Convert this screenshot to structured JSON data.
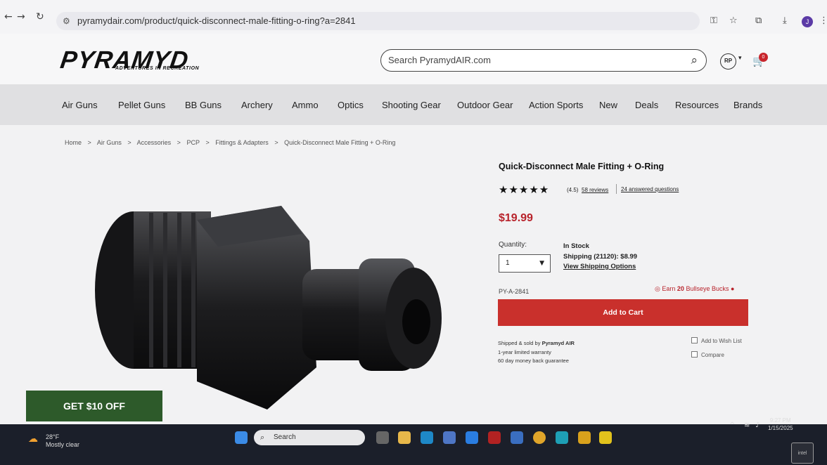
{
  "browser": {
    "url": "pyramydair.com/product/quick-disconnect-male-fitting-o-ring?a=2841",
    "profile_letter": "J"
  },
  "header": {
    "logo": "PYRAMYD",
    "tagline": "ADVENTURES IN RECREATION",
    "search_placeholder": "Search PyramydAIR.com",
    "account_initials": "RP",
    "cart_count": "0"
  },
  "nav": {
    "items": [
      "Air Guns",
      "Pellet Guns",
      "BB Guns",
      "Archery",
      "Ammo",
      "Optics",
      "Shooting Gear",
      "Outdoor Gear",
      "Action Sports",
      "New",
      "Deals",
      "Resources",
      "Brands"
    ]
  },
  "breadcrumb": {
    "items": [
      "Home",
      ">",
      "Air Guns",
      ">",
      "Accessories",
      ">",
      "PCP",
      ">",
      "Fittings & Adapters",
      ">",
      "Quick-Disconnect Male Fitting + O-Ring"
    ]
  },
  "product": {
    "title": "Quick-Disconnect Male Fitting + O-Ring",
    "stars": "★★★★★",
    "rating": "(4.5)",
    "reviews": "58 reviews",
    "answered": "24 answered questions",
    "price": "$19.99",
    "quantity_label": "Quantity:",
    "quantity_value": "1",
    "stock": "In Stock",
    "shipping": "Shipping (21120): $8.99",
    "shipping_options": "View Shipping Options",
    "sku": "PY-A-2841",
    "bucks_prefix": "Earn",
    "bucks_amount": "20",
    "bucks_suffix": "Bullseye Bucks",
    "add_to_cart": "Add to Cart",
    "shipped_by_prefix": "Shipped & sold by",
    "shipped_by_name": "Pyramyd AIR",
    "warranty": "1-year limited warranty",
    "guarantee": "60 day money back guarantee",
    "wishlist": "Add to Wish List",
    "compare": "Compare"
  },
  "promo": {
    "label": "GET $10 OFF"
  },
  "taskbar": {
    "temperature": "28°F",
    "weather": "Mostly clear",
    "search": "Search",
    "time": "9:27 PM",
    "date": "1/15/2025",
    "intel": "intel"
  },
  "colors": {
    "accent_red": "#c9302c",
    "promo_green": "#2d5a2a",
    "price_red": "#b8232b"
  }
}
